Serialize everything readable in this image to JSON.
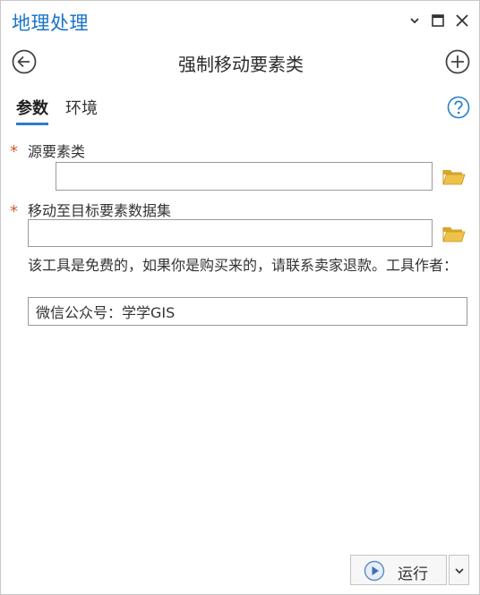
{
  "pane": {
    "title": "地理处理",
    "controls": {
      "collapse_icon": "chevron-down-icon",
      "maximize_icon": "maximize-icon",
      "close_icon": "close-icon"
    }
  },
  "header": {
    "tool_title": "强制移动要素类",
    "back_icon": "back-arrow-icon",
    "add_icon": "add-circle-icon"
  },
  "tabs": [
    {
      "label": "参数",
      "active": true
    },
    {
      "label": "环境",
      "active": false
    }
  ],
  "help_icon": "help-icon",
  "params": [
    {
      "label": "源要素类",
      "required": true,
      "value": "",
      "browse_icon": "folder-icon"
    },
    {
      "label": "移动至目标要素数据集",
      "required": true,
      "value": "",
      "browse_icon": "folder-icon"
    }
  ],
  "description": {
    "label": "该工具是免费的，如果你是购买来的，请联系卖家退款。工具作者：",
    "value": "微信公众号：学学GIS"
  },
  "run": {
    "label": "运行",
    "icon": "play-icon",
    "dropdown_icon": "chevron-down-icon"
  },
  "colors": {
    "accent": "#1a73c8",
    "required": "#d05a2a",
    "folder": "#e6b93b",
    "tab_underline": "#2a7ec8"
  }
}
